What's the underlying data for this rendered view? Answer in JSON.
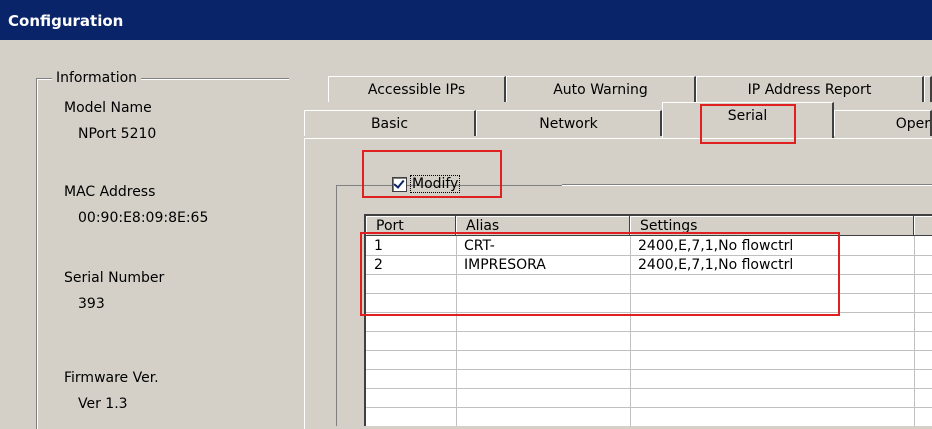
{
  "window": {
    "title": "Configuration"
  },
  "information": {
    "legend": "Information",
    "model_label": "Model Name",
    "model_value": "NPort 5210",
    "mac_label": "MAC Address",
    "mac_value": "00:90:E8:09:8E:65",
    "serial_label": "Serial Number",
    "serial_value": "393",
    "firmware_label": "Firmware Ver.",
    "firmware_value": "Ver 1.3"
  },
  "tabs": {
    "row1": [
      "Accessible IPs",
      "Auto Warning",
      "IP Address Report"
    ],
    "row2": [
      "Basic",
      "Network",
      "Serial",
      "Oper"
    ],
    "selected": "Serial"
  },
  "serial_panel": {
    "modify_label": "Modify",
    "modify_checked": true,
    "columns": [
      "Port",
      "Alias",
      "Settings"
    ],
    "rows": [
      {
        "port": "1",
        "alias": "CRT-",
        "settings": "2400,E,7,1,No flowctrl"
      },
      {
        "port": "2",
        "alias": "IMPRESORA",
        "settings": "2400,E,7,1,No flowctrl"
      }
    ]
  },
  "annotation_color": "#e02020"
}
